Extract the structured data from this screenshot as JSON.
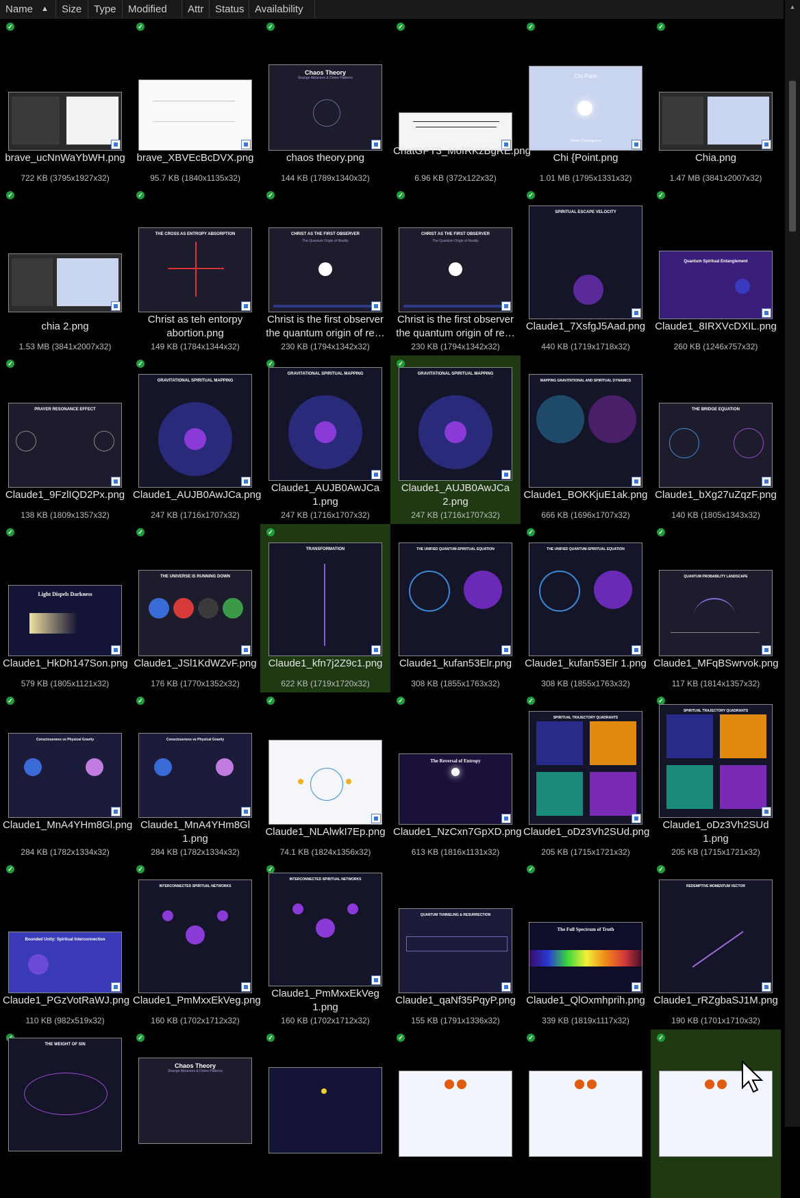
{
  "header": {
    "columns": [
      "Name",
      "Size",
      "Type",
      "Modified",
      "Attr",
      "Status",
      "Availability"
    ],
    "sort_icon": "sort-ascending-icon"
  },
  "files": [
    {
      "name": "brave_ucNnWaYbWH.png",
      "info": "722 KB (3795x1927x32)"
    },
    {
      "name": "brave_XBVEcBcDVX.png",
      "info": "95.7 KB (1840x1135x32)"
    },
    {
      "name": "chaos theory.png",
      "info": "144 KB (1789x1340x32)"
    },
    {
      "name": "ChatGPT3_MofRKzBgRE.png",
      "info": "6.96 KB (372x122x32)"
    },
    {
      "name": "Chi {Point.png",
      "info": "1.01 MB (1795x1331x32)"
    },
    {
      "name": "Chia.png",
      "info": "1.47 MB (3841x2007x32)"
    },
    {
      "name": "chia 2.png",
      "info": "1.53 MB (3841x2007x32)"
    },
    {
      "name": "Christ as teh entorpy abortion.png",
      "info": "149 KB (1784x1344x32)"
    },
    {
      "name": "Christ is the first observer the quantum origin of re…",
      "info": "230 KB (1794x1342x32)"
    },
    {
      "name": "Christ is the first observer the quantum origin of re…",
      "info": "230 KB (1794x1342x32)"
    },
    {
      "name": "Claude1_7XsfgJ5Aad.png",
      "info": "440 KB (1719x1718x32)"
    },
    {
      "name": "Claude1_8IRXVcDXIL.png",
      "info": "260 KB (1246x757x32)"
    },
    {
      "name": "Claude1_9FzlIQD2Px.png",
      "info": "138 KB (1809x1357x32)"
    },
    {
      "name": "Claude1_AUJB0AwJCa.png",
      "info": "247 KB (1716x1707x32)"
    },
    {
      "name": "Claude1_AUJB0AwJCa 1.png",
      "info": "247 KB (1716x1707x32)"
    },
    {
      "name": "Claude1_AUJB0AwJCa 2.png",
      "info": "247 KB (1716x1707x32)"
    },
    {
      "name": "Claude1_BOKKjuE1ak.png",
      "info": "666 KB (1696x1707x32)"
    },
    {
      "name": "Claude1_bXg27uZqzF.png",
      "info": "140 KB (1805x1343x32)"
    },
    {
      "name": "Claude1_HkDh147Son.png",
      "info": "579 KB (1805x1121x32)"
    },
    {
      "name": "Claude1_JSl1KdWZvF.png",
      "info": "176 KB (1770x1352x32)"
    },
    {
      "name": "Claude1_kfn7j2Z9c1.png",
      "info": "622 KB (1719x1720x32)"
    },
    {
      "name": "Claude1_kufan53Elr.png",
      "info": "308 KB (1855x1763x32)"
    },
    {
      "name": "Claude1_kufan53Elr 1.png",
      "info": "308 KB (1855x1763x32)"
    },
    {
      "name": "Claude1_MFqBSwrvok.png",
      "info": "117 KB (1814x1357x32)"
    },
    {
      "name": "Claude1_MnA4YHm8Gl.png",
      "info": "284 KB (1782x1334x32)"
    },
    {
      "name": "Claude1_MnA4YHm8Gl 1.png",
      "info": "284 KB (1782x1334x32)"
    },
    {
      "name": "Claude1_NLAlwkI7Ep.png",
      "info": "74.1 KB (1824x1356x32)"
    },
    {
      "name": "Claude1_NzCxn7GpXD.png",
      "info": "613 KB (1816x1131x32)"
    },
    {
      "name": "Claude1_oDz3Vh2SUd.png",
      "info": "205 KB (1715x1721x32)"
    },
    {
      "name": "Claude1_oDz3Vh2SUd 1.png",
      "info": "205 KB (1715x1721x32)"
    },
    {
      "name": "Claude1_PGzVotRaWJ.png",
      "info": "110 KB (982x519x32)"
    },
    {
      "name": "Claude1_PmMxxEkVeg.png",
      "info": "160 KB (1702x1712x32)"
    },
    {
      "name": "Claude1_PmMxxEkVeg 1.png",
      "info": "160 KB (1702x1712x32)"
    },
    {
      "name": "Claude1_qaNf35PqyP.png",
      "info": "155 KB (1791x1336x32)"
    },
    {
      "name": "Claude1_QlOxmhprih.png",
      "info": "339 KB (1819x1117x32)"
    },
    {
      "name": "Claude1_rRZgbaSJ1M.png",
      "info": "190 KB (1701x1710x32)"
    },
    {
      "name": "",
      "info": ""
    },
    {
      "name": "",
      "info": ""
    },
    {
      "name": "",
      "info": ""
    },
    {
      "name": "",
      "info": ""
    },
    {
      "name": "",
      "info": ""
    },
    {
      "name": "",
      "info": ""
    }
  ],
  "thumb_text": {
    "t2": "Chaos Theory",
    "t2s": "Strange Attractors & Divine Patterns",
    "t3": "Chi Point",
    "t3s": "Divine Convergence",
    "t4": "THE CROSS AS ENTROPY ABSORPTION",
    "t5": "CHRIST AS THE FIRST OBSERVER",
    "t5s": "The Quantum Origin of Reality",
    "t6": "SPIRITUAL ESCAPE VELOCITY",
    "t7": "Quantum Spiritual Entanglement",
    "t8": "PRAYER RESONANCE EFFECT",
    "t9": "GRAVITATIONAL SPIRITUAL MAPPING",
    "t10": "MAPPING GRAVITATIONAL AND SPIRITUAL DYNAMICS",
    "t11": "THE BRIDGE EQUATION",
    "t12": "Light Dispels Darkness",
    "t13": "THE UNIVERSE IS RUNNING DOWN",
    "t14": "TRANSFORMATION",
    "t15": "THE UNIFIED QUANTUM-SPIRITUAL EQUATION",
    "t16": "QUANTUM PROBABILITY LANDSCAPE",
    "t17": "Consciousness vs Physical Gravity",
    "t18": "The Reversal of Entropy",
    "t19": "SPIRITUAL TRAJECTORY QUADRANTS",
    "t20": "Bounded Unity: Spiritual Interconnection",
    "t21": "INTERCONNECTED SPIRITUAL NETWORKS",
    "t22": "QUANTUM TUNNELING & RESURRECTION",
    "t23": "The Full Spectrum of Truth",
    "t24": "REDEMPTIVE MOMENTUM VECTOR",
    "t25": "THE WEIGHT OF SIN"
  }
}
